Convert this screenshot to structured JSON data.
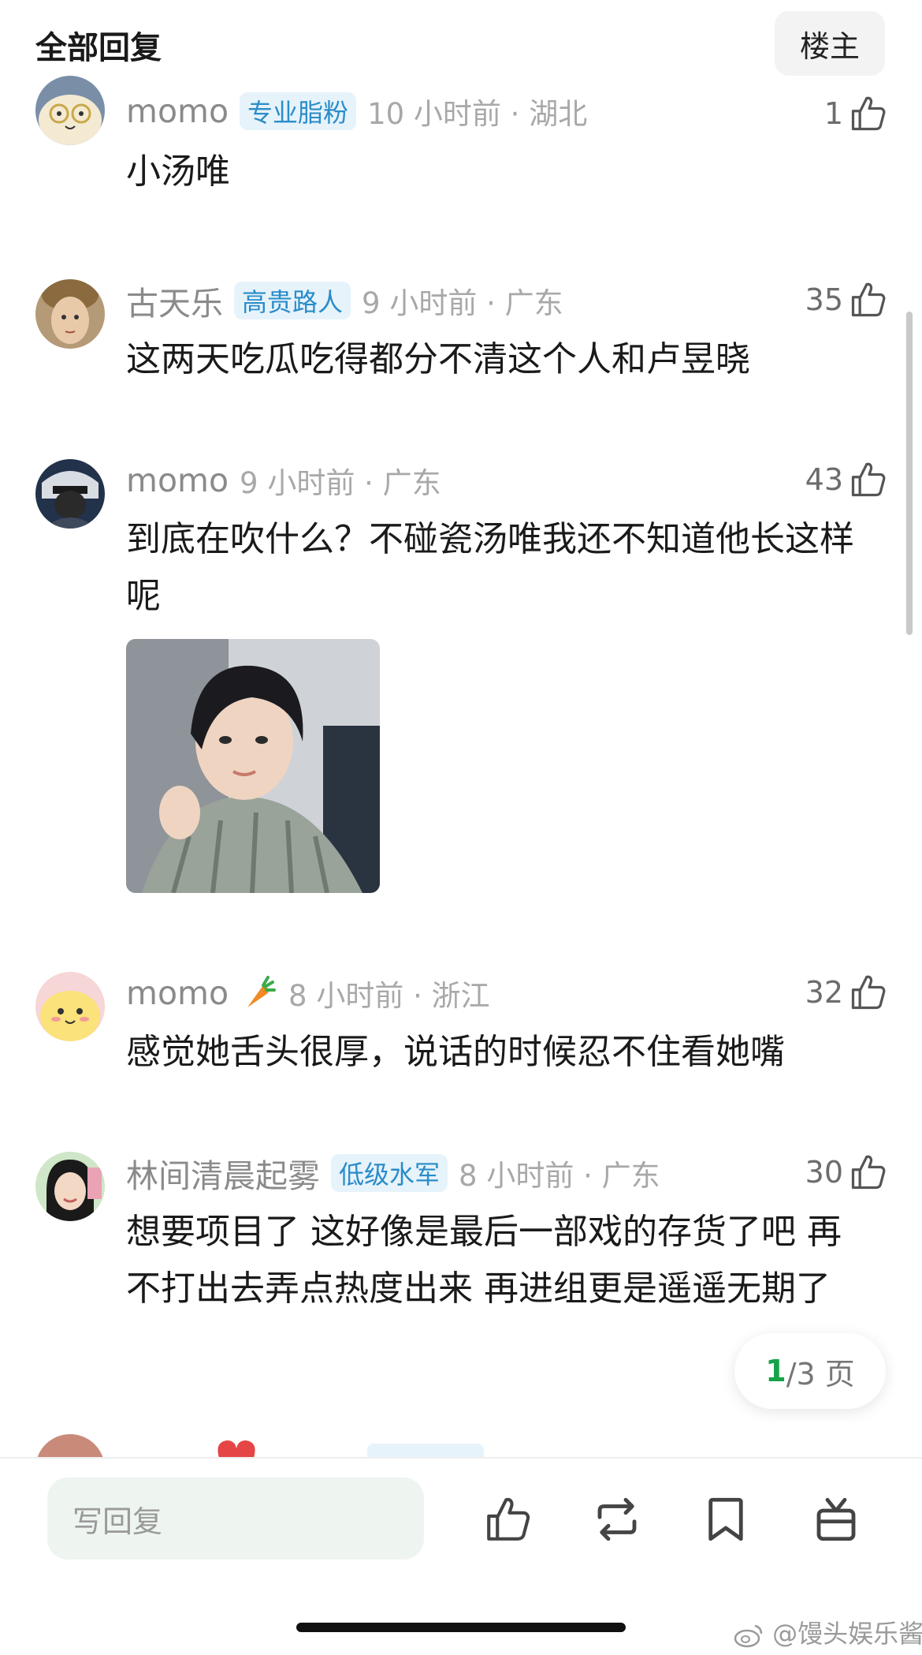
{
  "header": {
    "title": "全部回复",
    "op_button": "楼主"
  },
  "comments": [
    {
      "username": "momo",
      "badge": "专业脂粉",
      "time": "10 小时前 · 湖北",
      "likes": "1",
      "text": "小汤唯"
    },
    {
      "username": "古天乐",
      "badge": "高贵路人",
      "time": "9 小时前 · 广东",
      "likes": "35",
      "text": "这两天吃瓜吃得都分不清这个人和卢昱晓"
    },
    {
      "username": "momo",
      "time": "9 小时前 · 广东",
      "likes": "43",
      "text": "到底在吹什么？不碰瓷汤唯我还不知道他长这样呢"
    },
    {
      "username": "momo",
      "time": "8 小时前 · 浙江",
      "likes": "32",
      "text": "感觉她舌头很厚，说话的时候忍不住看她嘴"
    },
    {
      "username": "林间清晨起雾",
      "badge": "低级水军",
      "time": "8 小时前 · 广东",
      "likes": "30",
      "text": "想要项目了 这好像是最后一部戏的存货了吧 再不打出去弄点热度出来 再进组更是遥遥无期了"
    }
  ],
  "pager": {
    "current": "1",
    "total": "/3 页"
  },
  "bottom_bar": {
    "reply_placeholder": "写回复"
  },
  "watermark": "@馒头娱乐酱",
  "colors": {
    "badge_bg": "#e6f3fb",
    "badge_text": "#2a8cc8",
    "pager_current": "#17a34a"
  }
}
